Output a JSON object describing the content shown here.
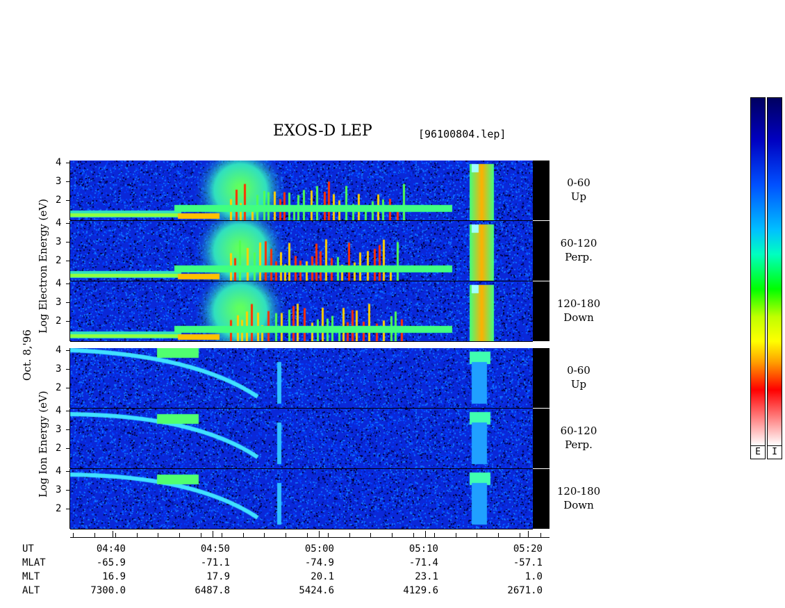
{
  "title": "EXOS-D LEP",
  "filename": "[96100804.lep]",
  "date_label": "Oct. 8,'96",
  "electron_axis_label": "Log  Electron  Energy (eV)",
  "ion_axis_label": "Log  Ion  Energy (eV)",
  "colorbar_labels": [
    "E",
    "I"
  ],
  "chart_data": {
    "type": "heatmap",
    "title": "EXOS-D LEP",
    "panels": [
      {
        "species": "Electron",
        "pitch_angle": "0-60",
        "direction": "Up"
      },
      {
        "species": "Electron",
        "pitch_angle": "60-120",
        "direction": "Perp."
      },
      {
        "species": "Electron",
        "pitch_angle": "120-180",
        "direction": "Down"
      },
      {
        "species": "Ion",
        "pitch_angle": "0-60",
        "direction": "Up"
      },
      {
        "species": "Ion",
        "pitch_angle": "60-120",
        "direction": "Perp."
      },
      {
        "species": "Ion",
        "pitch_angle": "120-180",
        "direction": "Down"
      }
    ],
    "y_ticks": [
      "4",
      "3",
      "2"
    ],
    "y_ticks_last": [
      "4",
      "3",
      "2"
    ],
    "ylim": [
      1,
      4.2
    ],
    "x_row_labels": [
      "UT",
      "MLAT",
      "MLT",
      "ALT"
    ],
    "x_ticks": [
      {
        "UT": "04:40",
        "MLAT": "-65.9",
        "MLT": "16.9",
        "ALT": "7300.0"
      },
      {
        "UT": "04:50",
        "MLAT": "-71.1",
        "MLT": "17.9",
        "ALT": "6487.8"
      },
      {
        "UT": "05:00",
        "MLAT": "-74.9",
        "MLT": "20.1",
        "ALT": "5424.6"
      },
      {
        "UT": "05:10",
        "MLAT": "-71.4",
        "MLT": "23.1",
        "ALT": "4129.6"
      },
      {
        "UT": "05:20",
        "MLAT": "-57.1",
        "MLT": "1.0",
        "ALT": "2671.0"
      }
    ],
    "xlim_minutes_ut": [
      "04:37",
      "05:23"
    ],
    "colormap": [
      "#ffffff",
      "#ff0000",
      "#ffff00",
      "#00ff00",
      "#00ffff",
      "#0000ff",
      "#000080"
    ]
  }
}
